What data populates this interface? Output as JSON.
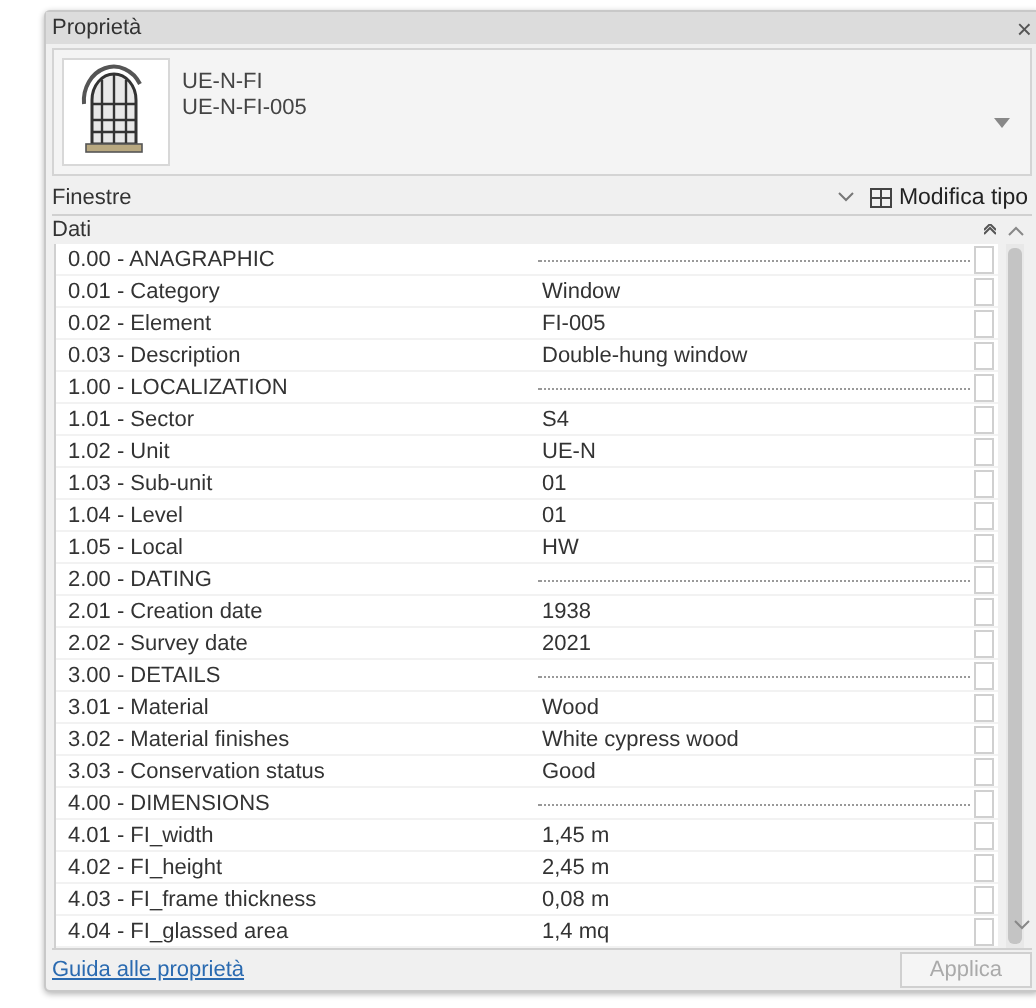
{
  "window": {
    "title": "Proprietà",
    "close": "×"
  },
  "type_selector": {
    "family": "UE-N-FI",
    "type": "UE-N-FI-005"
  },
  "filter": {
    "category": "Finestre",
    "edit_type": "Modifica tipo"
  },
  "section": {
    "title": "Dati",
    "expanded": true
  },
  "rows": [
    {
      "kind": "group",
      "label": "0.00 - ANAGRAPHIC",
      "checked": false
    },
    {
      "kind": "param",
      "label": "0.01 - Category",
      "value": "Window",
      "checked": false
    },
    {
      "kind": "param",
      "label": "0.02 - Element",
      "value": "FI-005",
      "checked": false
    },
    {
      "kind": "param",
      "label": "0.03 - Description",
      "value": "Double-hung window",
      "checked": false
    },
    {
      "kind": "group",
      "label": "1.00 - LOCALIZATION",
      "checked": false
    },
    {
      "kind": "param",
      "label": "1.01 - Sector",
      "value": "S4",
      "checked": false
    },
    {
      "kind": "param",
      "label": "1.02 - Unit",
      "value": "UE-N",
      "checked": false
    },
    {
      "kind": "param",
      "label": "1.03 - Sub-unit",
      "value": "01",
      "checked": false
    },
    {
      "kind": "param",
      "label": "1.04 - Level",
      "value": "01",
      "checked": false
    },
    {
      "kind": "param",
      "label": "1.05 - Local",
      "value": "HW",
      "checked": false
    },
    {
      "kind": "group",
      "label": "2.00 - DATING",
      "checked": false
    },
    {
      "kind": "param",
      "label": "2.01 - Creation date",
      "value": "1938",
      "checked": false
    },
    {
      "kind": "param",
      "label": "2.02 - Survey date",
      "value": "2021",
      "checked": false
    },
    {
      "kind": "group",
      "label": "3.00 - DETAILS",
      "checked": false
    },
    {
      "kind": "param",
      "label": "3.01 - Material",
      "value": "Wood",
      "checked": false
    },
    {
      "kind": "param",
      "label": "3.02 - Material finishes",
      "value": "White cypress wood",
      "checked": false
    },
    {
      "kind": "param",
      "label": "3.03 - Conservation status",
      "value": "Good",
      "checked": false
    },
    {
      "kind": "group",
      "label": "4.00 - DIMENSIONS",
      "checked": false
    },
    {
      "kind": "param",
      "label": "4.01 - FI_width",
      "value": "1,45 m",
      "checked": false
    },
    {
      "kind": "param",
      "label": "4.02 - FI_height",
      "value": "2,45 m",
      "checked": false
    },
    {
      "kind": "param",
      "label": "4.03 - FI_frame thickness",
      "value": "0,08 m",
      "checked": false
    },
    {
      "kind": "param",
      "label": "4.04 - FI_glassed area",
      "value": "1,4 mq",
      "checked": false
    }
  ],
  "footer": {
    "help_link": "Guida alle proprietà",
    "apply": {
      "label": "Applica",
      "disabled": true
    }
  }
}
